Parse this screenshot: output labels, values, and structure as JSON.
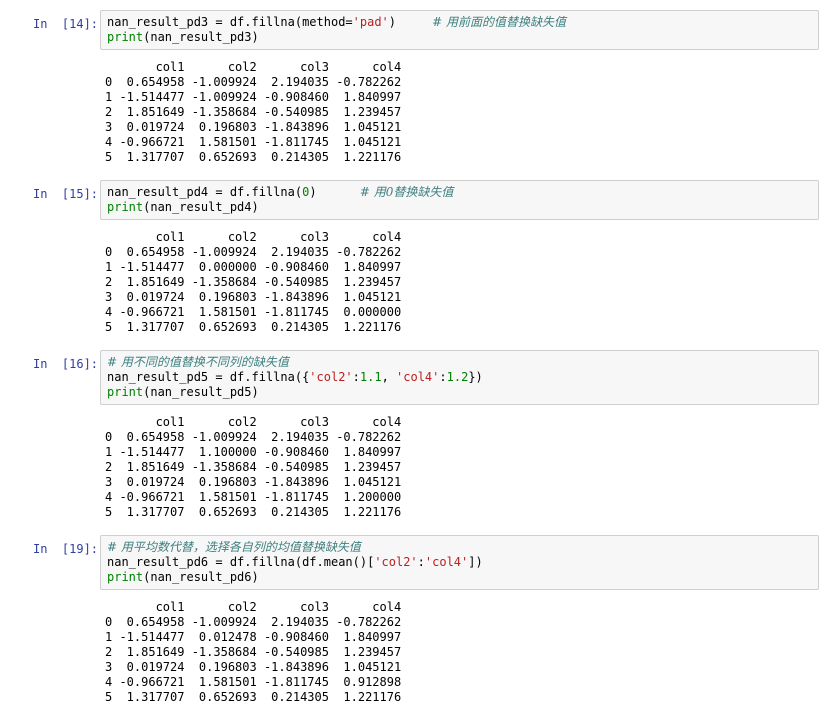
{
  "cells": [
    {
      "prompt": "In  [14]:",
      "code": [
        [
          {
            "t": "plain",
            "v": "nan_result_pd3 = df.fillna(method="
          },
          {
            "t": "str",
            "v": "'pad'"
          },
          {
            "t": "plain",
            "v": ")     "
          },
          {
            "t": "com",
            "v": "# 用前面的值替换缺失值"
          }
        ],
        [
          {
            "t": "kw",
            "v": "print"
          },
          {
            "t": "plain",
            "v": "(nan_result_pd3)"
          }
        ]
      ],
      "output": {
        "header": "       col1      col2      col3      col4",
        "rows": [
          "0  0.654958 -1.009924  2.194035 -0.782262",
          "1 -1.514477 -1.009924 -0.908460  1.840997",
          "2  1.851649 -1.358684 -0.540985  1.239457",
          "3  0.019724  0.196803 -1.843896  1.045121",
          "4 -0.966721  1.581501 -1.811745  1.045121",
          "5  1.317707  0.652693  0.214305  1.221176"
        ]
      }
    },
    {
      "prompt": "In  [15]:",
      "code": [
        [
          {
            "t": "plain",
            "v": "nan_result_pd4 = df.fillna("
          },
          {
            "t": "num",
            "v": "0"
          },
          {
            "t": "plain",
            "v": ")      "
          },
          {
            "t": "com",
            "v": "# 用0替换缺失值"
          }
        ],
        [
          {
            "t": "kw",
            "v": "print"
          },
          {
            "t": "plain",
            "v": "(nan_result_pd4)"
          }
        ]
      ],
      "output": {
        "header": "       col1      col2      col3      col4",
        "rows": [
          "0  0.654958 -1.009924  2.194035 -0.782262",
          "1 -1.514477  0.000000 -0.908460  1.840997",
          "2  1.851649 -1.358684 -0.540985  1.239457",
          "3  0.019724  0.196803 -1.843896  1.045121",
          "4 -0.966721  1.581501 -1.811745  0.000000",
          "5  1.317707  0.652693  0.214305  1.221176"
        ]
      }
    },
    {
      "prompt": "In  [16]:",
      "code": [
        [
          {
            "t": "com",
            "v": "# 用不同的值替换不同列的缺失值"
          }
        ],
        [
          {
            "t": "plain",
            "v": "nan_result_pd5 = df.fillna({"
          },
          {
            "t": "str",
            "v": "'col2'"
          },
          {
            "t": "plain",
            "v": ":"
          },
          {
            "t": "num",
            "v": "1.1"
          },
          {
            "t": "plain",
            "v": ", "
          },
          {
            "t": "str",
            "v": "'col4'"
          },
          {
            "t": "plain",
            "v": ":"
          },
          {
            "t": "num",
            "v": "1.2"
          },
          {
            "t": "plain",
            "v": "})"
          }
        ],
        [
          {
            "t": "kw",
            "v": "print"
          },
          {
            "t": "plain",
            "v": "(nan_result_pd5)"
          }
        ]
      ],
      "output": {
        "header": "       col1      col2      col3      col4",
        "rows": [
          "0  0.654958 -1.009924  2.194035 -0.782262",
          "1 -1.514477  1.100000 -0.908460  1.840997",
          "2  1.851649 -1.358684 -0.540985  1.239457",
          "3  0.019724  0.196803 -1.843896  1.045121",
          "4 -0.966721  1.581501 -1.811745  1.200000",
          "5  1.317707  0.652693  0.214305  1.221176"
        ]
      }
    },
    {
      "prompt": "In  [19]:",
      "code": [
        [
          {
            "t": "com",
            "v": "# 用平均数代替，选择各自列的均值替换缺失值"
          }
        ],
        [
          {
            "t": "plain",
            "v": "nan_result_pd6 = df.fillna(df.mean()["
          },
          {
            "t": "str",
            "v": "'col2'"
          },
          {
            "t": "plain",
            "v": ":"
          },
          {
            "t": "str",
            "v": "'col4'"
          },
          {
            "t": "plain",
            "v": "])"
          }
        ],
        [
          {
            "t": "kw",
            "v": "print"
          },
          {
            "t": "plain",
            "v": "(nan_result_pd6)"
          }
        ]
      ],
      "output": {
        "header": "       col1      col2      col3      col4",
        "rows": [
          "0  0.654958 -1.009924  2.194035 -0.782262",
          "1 -1.514477  0.012478 -0.908460  1.840997",
          "2  1.851649 -1.358684 -0.540985  1.239457",
          "3  0.019724  0.196803 -1.843896  1.045121",
          "4 -0.966721  1.581501 -1.811745  0.912898",
          "5  1.317707  0.652693  0.214305  1.221176"
        ]
      }
    }
  ],
  "colors": {
    "prompt": "#303f9f",
    "keyword": "#008000",
    "string": "#ba2121",
    "comment": "#408080",
    "input_bg": "#f7f7f7",
    "input_border": "#cfcfcf"
  }
}
